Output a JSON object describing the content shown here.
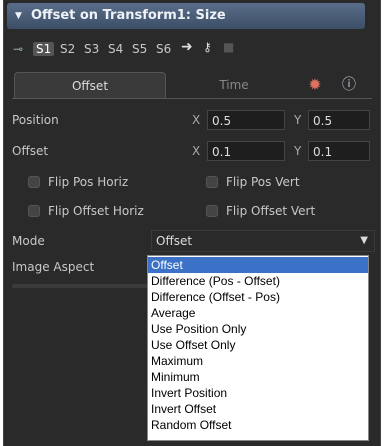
{
  "window": {
    "title": "Offset on Transform1: Size"
  },
  "toolbar": {
    "buttons": [
      "S1",
      "S2",
      "S3",
      "S4",
      "S5",
      "S6"
    ],
    "active": "S1"
  },
  "tabs": {
    "offset": "Offset",
    "time": "Time"
  },
  "controls": {
    "position": {
      "label": "Position",
      "x_axis": "X",
      "x": "0.5",
      "y_axis": "Y",
      "y": "0.5"
    },
    "offset": {
      "label": "Offset",
      "x_axis": "X",
      "x": "0.1",
      "y_axis": "Y",
      "y": "0.1"
    },
    "flip_pos_horiz": "Flip Pos Horiz",
    "flip_pos_vert": "Flip Pos Vert",
    "flip_offset_horiz": "Flip Offset Horiz",
    "flip_offset_vert": "Flip Offset Vert",
    "mode": {
      "label": "Mode",
      "value": "Offset"
    },
    "image_aspect": {
      "label": "Image Aspect"
    }
  },
  "mode_menu": {
    "options": [
      "Offset",
      "Difference (Pos - Offset)",
      "Difference (Offset - Pos)",
      "Average",
      "Use Position Only",
      "Use Offset Only",
      "Maximum",
      "Minimum",
      "Invert Position",
      "Invert Offset",
      "Random Offset"
    ],
    "selected": "Offset"
  },
  "colors": {
    "title_bar": "#4a5d78",
    "panel_bg": "#2a2a2a",
    "menu_highlight": "#3b72c8",
    "gear": "#e07060"
  },
  "icons": [
    "collapse-arrow-icon",
    "pin-icon",
    "arrow-right-icon",
    "key-icon",
    "lock-icon",
    "gear-icon",
    "info-icon",
    "dropdown-caret-icon"
  ]
}
